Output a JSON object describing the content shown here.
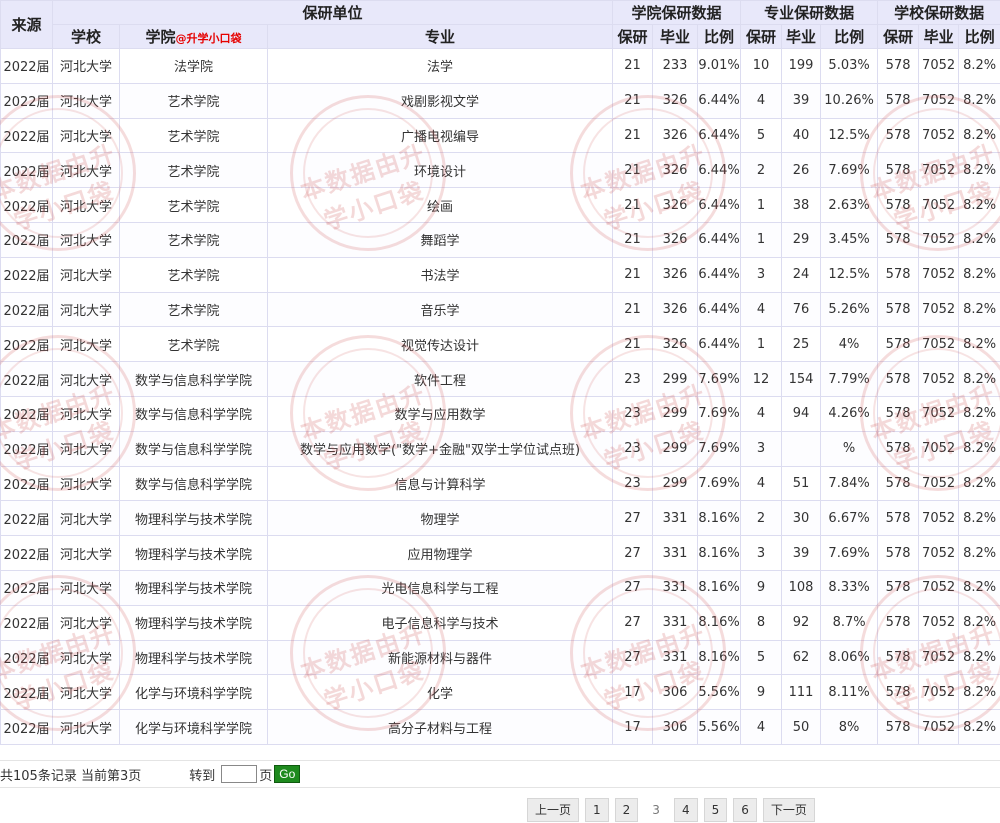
{
  "header": {
    "source": "来源",
    "unit_group": "保研单位",
    "school": "学校",
    "college": "学院",
    "college_tag": "@升学小口袋",
    "major": "专业",
    "college_group": "学院保研数据",
    "major_group": "专业保研数据",
    "school_group": "学校保研数据",
    "baoyan": "保研",
    "graduates": "毕业",
    "ratio": "比例"
  },
  "rows": [
    {
      "source": "2022届",
      "school": "河北大学",
      "college": "法学院",
      "major": "法学",
      "c_by": "21",
      "c_grad": "233",
      "c_ratio": "9.01%",
      "m_by": "10",
      "m_grad": "199",
      "m_ratio": "5.03%",
      "s_by": "578",
      "s_grad": "7052",
      "s_ratio": "8.2%"
    },
    {
      "source": "2022届",
      "school": "河北大学",
      "college": "艺术学院",
      "major": "戏剧影视文学",
      "c_by": "21",
      "c_grad": "326",
      "c_ratio": "6.44%",
      "m_by": "4",
      "m_grad": "39",
      "m_ratio": "10.26%",
      "s_by": "578",
      "s_grad": "7052",
      "s_ratio": "8.2%"
    },
    {
      "source": "2022届",
      "school": "河北大学",
      "college": "艺术学院",
      "major": "广播电视编导",
      "c_by": "21",
      "c_grad": "326",
      "c_ratio": "6.44%",
      "m_by": "5",
      "m_grad": "40",
      "m_ratio": "12.5%",
      "s_by": "578",
      "s_grad": "7052",
      "s_ratio": "8.2%"
    },
    {
      "source": "2022届",
      "school": "河北大学",
      "college": "艺术学院",
      "major": "环境设计",
      "c_by": "21",
      "c_grad": "326",
      "c_ratio": "6.44%",
      "m_by": "2",
      "m_grad": "26",
      "m_ratio": "7.69%",
      "s_by": "578",
      "s_grad": "7052",
      "s_ratio": "8.2%"
    },
    {
      "source": "2022届",
      "school": "河北大学",
      "college": "艺术学院",
      "major": "绘画",
      "c_by": "21",
      "c_grad": "326",
      "c_ratio": "6.44%",
      "m_by": "1",
      "m_grad": "38",
      "m_ratio": "2.63%",
      "s_by": "578",
      "s_grad": "7052",
      "s_ratio": "8.2%"
    },
    {
      "source": "2022届",
      "school": "河北大学",
      "college": "艺术学院",
      "major": "舞蹈学",
      "c_by": "21",
      "c_grad": "326",
      "c_ratio": "6.44%",
      "m_by": "1",
      "m_grad": "29",
      "m_ratio": "3.45%",
      "s_by": "578",
      "s_grad": "7052",
      "s_ratio": "8.2%"
    },
    {
      "source": "2022届",
      "school": "河北大学",
      "college": "艺术学院",
      "major": "书法学",
      "c_by": "21",
      "c_grad": "326",
      "c_ratio": "6.44%",
      "m_by": "3",
      "m_grad": "24",
      "m_ratio": "12.5%",
      "s_by": "578",
      "s_grad": "7052",
      "s_ratio": "8.2%"
    },
    {
      "source": "2022届",
      "school": "河北大学",
      "college": "艺术学院",
      "major": "音乐学",
      "c_by": "21",
      "c_grad": "326",
      "c_ratio": "6.44%",
      "m_by": "4",
      "m_grad": "76",
      "m_ratio": "5.26%",
      "s_by": "578",
      "s_grad": "7052",
      "s_ratio": "8.2%"
    },
    {
      "source": "2022届",
      "school": "河北大学",
      "college": "艺术学院",
      "major": "视觉传达设计",
      "c_by": "21",
      "c_grad": "326",
      "c_ratio": "6.44%",
      "m_by": "1",
      "m_grad": "25",
      "m_ratio": "4%",
      "s_by": "578",
      "s_grad": "7052",
      "s_ratio": "8.2%"
    },
    {
      "source": "2022届",
      "school": "河北大学",
      "college": "数学与信息科学学院",
      "major": "软件工程",
      "c_by": "23",
      "c_grad": "299",
      "c_ratio": "7.69%",
      "m_by": "12",
      "m_grad": "154",
      "m_ratio": "7.79%",
      "s_by": "578",
      "s_grad": "7052",
      "s_ratio": "8.2%"
    },
    {
      "source": "2022届",
      "school": "河北大学",
      "college": "数学与信息科学学院",
      "major": "数学与应用数学",
      "c_by": "23",
      "c_grad": "299",
      "c_ratio": "7.69%",
      "m_by": "4",
      "m_grad": "94",
      "m_ratio": "4.26%",
      "s_by": "578",
      "s_grad": "7052",
      "s_ratio": "8.2%"
    },
    {
      "source": "2022届",
      "school": "河北大学",
      "college": "数学与信息科学学院",
      "major": "数学与应用数学(\"数学+金融\"双学士学位试点班)",
      "c_by": "23",
      "c_grad": "299",
      "c_ratio": "7.69%",
      "m_by": "3",
      "m_grad": "",
      "m_ratio": "%",
      "s_by": "578",
      "s_grad": "7052",
      "s_ratio": "8.2%"
    },
    {
      "source": "2022届",
      "school": "河北大学",
      "college": "数学与信息科学学院",
      "major": "信息与计算科学",
      "c_by": "23",
      "c_grad": "299",
      "c_ratio": "7.69%",
      "m_by": "4",
      "m_grad": "51",
      "m_ratio": "7.84%",
      "s_by": "578",
      "s_grad": "7052",
      "s_ratio": "8.2%"
    },
    {
      "source": "2022届",
      "school": "河北大学",
      "college": "物理科学与技术学院",
      "major": "物理学",
      "c_by": "27",
      "c_grad": "331",
      "c_ratio": "8.16%",
      "m_by": "2",
      "m_grad": "30",
      "m_ratio": "6.67%",
      "s_by": "578",
      "s_grad": "7052",
      "s_ratio": "8.2%"
    },
    {
      "source": "2022届",
      "school": "河北大学",
      "college": "物理科学与技术学院",
      "major": "应用物理学",
      "c_by": "27",
      "c_grad": "331",
      "c_ratio": "8.16%",
      "m_by": "3",
      "m_grad": "39",
      "m_ratio": "7.69%",
      "s_by": "578",
      "s_grad": "7052",
      "s_ratio": "8.2%"
    },
    {
      "source": "2022届",
      "school": "河北大学",
      "college": "物理科学与技术学院",
      "major": "光电信息科学与工程",
      "c_by": "27",
      "c_grad": "331",
      "c_ratio": "8.16%",
      "m_by": "9",
      "m_grad": "108",
      "m_ratio": "8.33%",
      "s_by": "578",
      "s_grad": "7052",
      "s_ratio": "8.2%"
    },
    {
      "source": "2022届",
      "school": "河北大学",
      "college": "物理科学与技术学院",
      "major": "电子信息科学与技术",
      "c_by": "27",
      "c_grad": "331",
      "c_ratio": "8.16%",
      "m_by": "8",
      "m_grad": "92",
      "m_ratio": "8.7%",
      "s_by": "578",
      "s_grad": "7052",
      "s_ratio": "8.2%"
    },
    {
      "source": "2022届",
      "school": "河北大学",
      "college": "物理科学与技术学院",
      "major": "新能源材料与器件",
      "c_by": "27",
      "c_grad": "331",
      "c_ratio": "8.16%",
      "m_by": "5",
      "m_grad": "62",
      "m_ratio": "8.06%",
      "s_by": "578",
      "s_grad": "7052",
      "s_ratio": "8.2%"
    },
    {
      "source": "2022届",
      "school": "河北大学",
      "college": "化学与环境科学学院",
      "major": "化学",
      "c_by": "17",
      "c_grad": "306",
      "c_ratio": "5.56%",
      "m_by": "9",
      "m_grad": "111",
      "m_ratio": "8.11%",
      "s_by": "578",
      "s_grad": "7052",
      "s_ratio": "8.2%"
    },
    {
      "source": "2022届",
      "school": "河北大学",
      "college": "化学与环境科学学院",
      "major": "高分子材料与工程",
      "c_by": "17",
      "c_grad": "306",
      "c_ratio": "5.56%",
      "m_by": "4",
      "m_grad": "50",
      "m_ratio": "8%",
      "s_by": "578",
      "s_grad": "7052",
      "s_ratio": "8.2%"
    }
  ],
  "watermark": {
    "text": "本数据由升学小口袋",
    "icon": "stamp-watermark",
    "color": "#cd5050"
  },
  "footer": {
    "records_text": "共105条记录 当前第3页",
    "goto_label": "转到",
    "goto_value": "",
    "page_unit": "页",
    "go_label": "Go"
  },
  "pagination": {
    "prev": "上一页",
    "pages": [
      "1",
      "2",
      "3",
      "4",
      "5",
      "6"
    ],
    "current": "3",
    "next": "下一页"
  }
}
